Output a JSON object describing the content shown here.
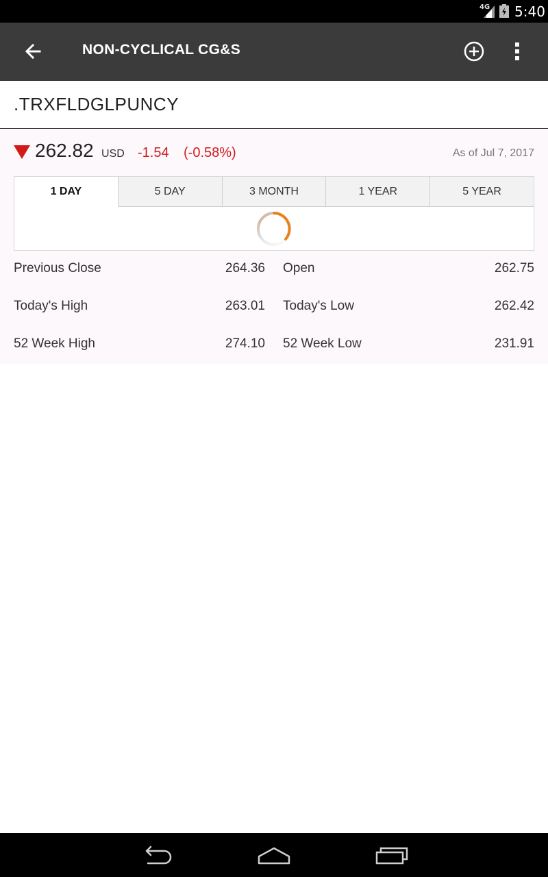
{
  "status_bar": {
    "network": "4G",
    "time": "5:40"
  },
  "app_bar": {
    "title": "NON-CYCLICAL CG&S"
  },
  "symbol": ".TRXFLDGLPUNCY",
  "quote": {
    "price": "262.82",
    "currency": "USD",
    "change": "-1.54",
    "change_percent": "(-0.58%)",
    "as_of": "As of Jul 7, 2017",
    "direction": "down",
    "down_color": "#d11a1a"
  },
  "tabs": [
    {
      "label": "1 DAY",
      "active": true
    },
    {
      "label": "5 DAY",
      "active": false
    },
    {
      "label": "3 MONTH",
      "active": false
    },
    {
      "label": "1 YEAR",
      "active": false
    },
    {
      "label": "5 YEAR",
      "active": false
    }
  ],
  "stats": [
    {
      "left_label": "Previous Close",
      "left_value": "264.36",
      "right_label": "Open",
      "right_value": "262.75"
    },
    {
      "left_label": "Today's High",
      "left_value": "263.01",
      "right_label": "Today's Low",
      "right_value": "262.42"
    },
    {
      "left_label": "52 Week High",
      "left_value": "274.10",
      "right_label": "52 Week Low",
      "right_value": "231.91"
    }
  ],
  "icons": {
    "back": "arrow-left-icon",
    "add": "plus-circle-icon",
    "more": "more-vert-icon",
    "loading": "spinner-icon"
  },
  "accent": "#e8821e"
}
